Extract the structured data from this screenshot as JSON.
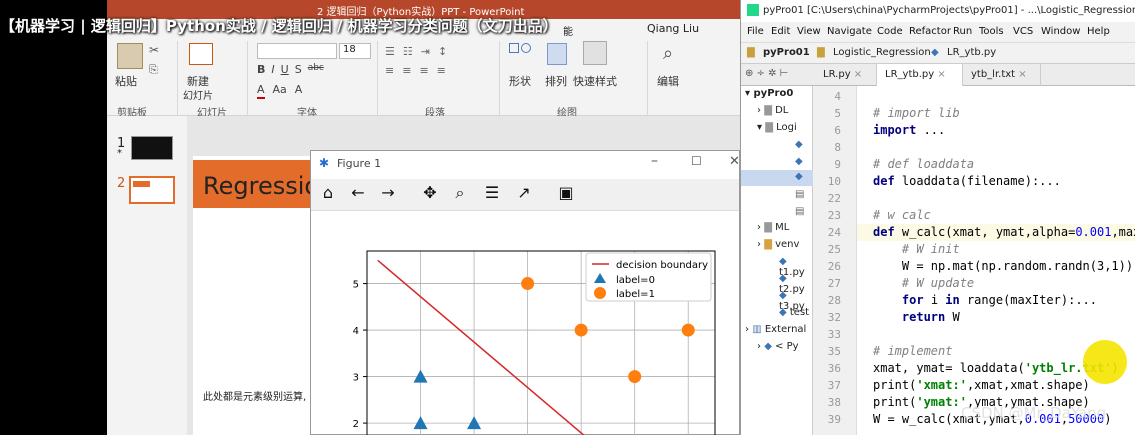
{
  "overlay_title": "【机器学习 | 逻辑回归】Python实战 / 逻辑回归 / 机器学习分类问题（文刀出品）",
  "ppt": {
    "window_title": "2 逻辑回归（Python实战）PPT - PowerPoint",
    "user": "Qiang Liu",
    "tab_fragment": "能",
    "buttons": {
      "paste": "粘贴",
      "new_slide": "新建",
      "new_slide_sub": "幻灯片",
      "shape": "形状",
      "arrange": "排列",
      "quick_style": "快速样式",
      "edit": "编辑"
    },
    "groups": {
      "clipboard": "剪贴板",
      "slides": "幻灯片",
      "font": "字体",
      "paragraph": "段落",
      "drawing": "绘图"
    },
    "font_size": "18",
    "font_buttons": [
      "B",
      "I",
      "U",
      "S",
      "abc",
      "A",
      "Aa",
      "A"
    ],
    "slide_numbers": [
      "1",
      "2"
    ],
    "slide_star": "*",
    "banner_text": "Regressio",
    "slide_text": "此处都是元素级别运算,"
  },
  "figure": {
    "title": "Figure 1",
    "toolbar": [
      "home-icon",
      "back-icon",
      "forward-icon",
      "pan-icon",
      "zoom-icon",
      "configure-icon",
      "axes-edit-icon",
      "save-icon"
    ],
    "legend": [
      "decision boundary",
      "label=0",
      "label=1"
    ]
  },
  "chart_data": {
    "type": "scatter",
    "xlim": [
      0,
      6.5
    ],
    "ylim": [
      1.4,
      5.7
    ],
    "yticks": [
      2,
      3,
      4,
      5
    ],
    "grid": true,
    "legend_position": "top-right",
    "series": [
      {
        "name": "decision boundary",
        "type": "line",
        "color": "#d62728",
        "points": [
          [
            0.2,
            5.5
          ],
          [
            4.5,
            1.3
          ]
        ]
      },
      {
        "name": "label=0",
        "type": "scatter",
        "marker": "triangle",
        "color": "#1f77b4",
        "points": [
          [
            1,
            3
          ],
          [
            1,
            2
          ],
          [
            2,
            2
          ]
        ]
      },
      {
        "name": "label=1",
        "type": "scatter",
        "marker": "circle",
        "color": "#ff7f0e",
        "points": [
          [
            3,
            5
          ],
          [
            4,
            4
          ],
          [
            6,
            4
          ],
          [
            5,
            3
          ]
        ]
      }
    ]
  },
  "pycharm": {
    "title": "pyPro01 [C:\\Users\\china\\PycharmProjects\\pyPro01] - ...\\Logistic_Regression\\LR_y",
    "menu": [
      "File",
      "Edit",
      "View",
      "Navigate",
      "Code",
      "Refactor",
      "Run",
      "Tools",
      "VCS",
      "Window",
      "Help"
    ],
    "breadcrumb": [
      "pyPro01",
      "Logistic_Regression",
      "LR_ytb.py"
    ],
    "tabs": [
      "LR.py",
      "LR_ytb.py",
      "ytb_lr.txt"
    ],
    "project_tree": [
      "pyPro0",
      "DL",
      "Logi",
      "ML",
      "venv",
      "t1.py",
      "t2.py",
      "t3.py",
      "test",
      "External",
      "< Py"
    ],
    "line_numbers": [
      "4",
      "5",
      "6",
      "8",
      "9",
      "10",
      "22",
      "23",
      "24",
      "25",
      "26",
      "27",
      "28",
      "32",
      "33",
      "35",
      "36",
      "37",
      "38",
      "39"
    ],
    "code_lines": [
      "",
      "# import lib",
      "import ...",
      "",
      "# def loaddata",
      "def loaddata(filename):...",
      "",
      "# w calc",
      "def w_calc(xmat, ymat,alpha=0.001,maxI",
      "    # W init",
      "    W = np.mat(np.random.randn(3,1))",
      "    # W update",
      "    for i in range(maxIter):...",
      "    return W",
      "",
      "# implement",
      "xmat, ymat= loaddata('ytb_lr.txt')",
      "print('xmat:',xmat,xmat.shape)",
      "print('ymat:',ymat,ymat.shape)",
      "W = w_calc(xmat,ymat,0.001,50000)"
    ],
    "watermark": "CSDN @Mr_DaYang"
  }
}
